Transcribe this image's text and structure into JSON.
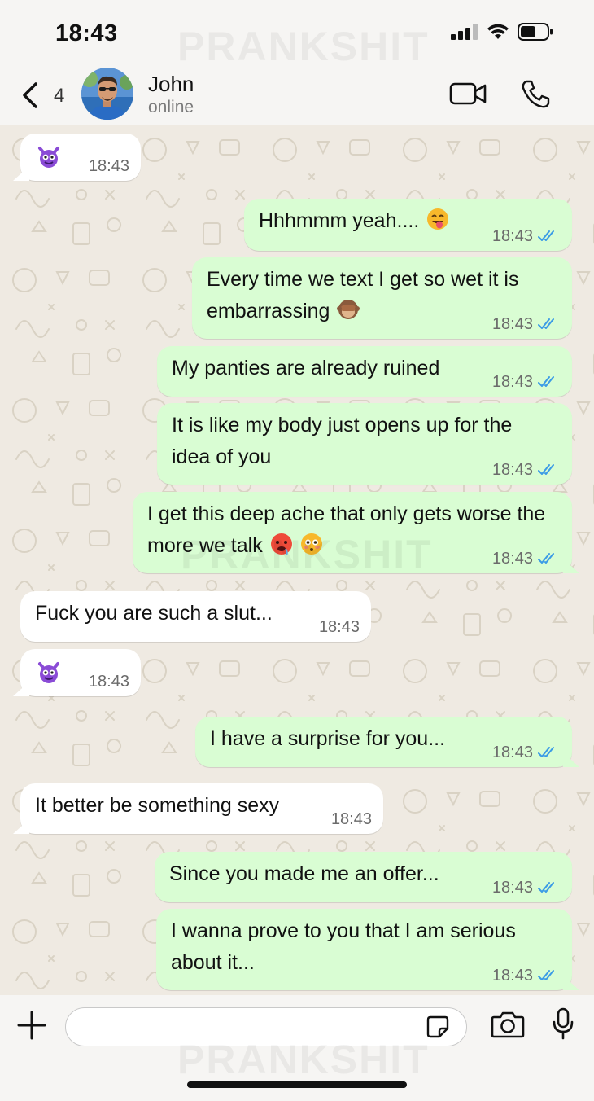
{
  "status_bar": {
    "time": "18:43",
    "watermark": "PRANKSHIT"
  },
  "header": {
    "back_count": "4",
    "contact_name": "John",
    "contact_status": "online"
  },
  "messages": [
    {
      "dir": "in",
      "text": "",
      "emoji": "smiling-devil",
      "time": "18:43"
    },
    {
      "dir": "out",
      "text": "Hhhmmm yeah....",
      "emoji": "winking-tongue-face",
      "time": "18:43"
    },
    {
      "dir": "out",
      "text": "Every time we text I get so wet it is embarrassing",
      "emoji": "see-no-evil-monkey",
      "time": "18:43"
    },
    {
      "dir": "out",
      "text": "My panties are already ruined",
      "time": "18:43"
    },
    {
      "dir": "out",
      "text": "It is like my body just opens up for the idea of you",
      "time": "18:43"
    },
    {
      "dir": "out",
      "text": "I get this deep ache that only gets worse the more we talk",
      "emoji": "hot-face, flushed-face",
      "time": "18:43"
    },
    {
      "dir": "in",
      "text": "Fuck you are such a slut...",
      "time": "18:43"
    },
    {
      "dir": "in",
      "text": "",
      "emoji": "smiling-devil",
      "time": "18:43"
    },
    {
      "dir": "out",
      "text": "I have a surprise for you...",
      "time": "18:43"
    },
    {
      "dir": "in",
      "text": "It better be something sexy",
      "time": "18:43"
    },
    {
      "dir": "out",
      "text": "Since you made me an offer...",
      "time": "18:43"
    },
    {
      "dir": "out",
      "text": "I wanna prove to you that I am serious about it...",
      "time": "18:43"
    }
  ],
  "composer": {
    "placeholder": ""
  },
  "colors": {
    "outgoing_bubble": "#d9fdd3",
    "incoming_bubble": "#ffffff",
    "read_ticks": "#3b9be6",
    "chat_bg": "#efeae2"
  }
}
